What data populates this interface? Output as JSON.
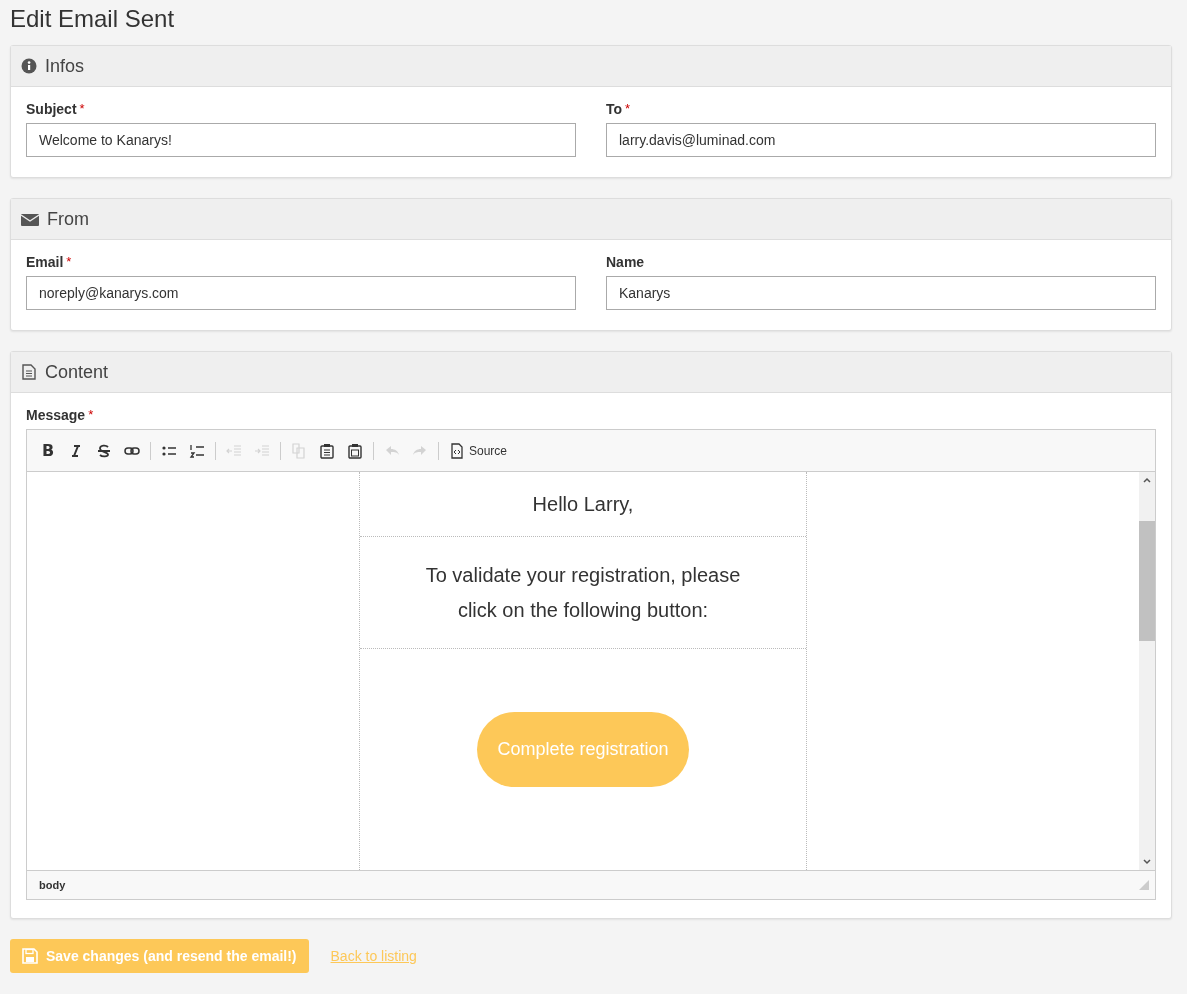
{
  "page_title": "Edit Email Sent",
  "panels": [
    {
      "title": "Infos",
      "fields": [
        {
          "label": "Subject",
          "required_mark": "*",
          "value": "Welcome to Kanarys!"
        },
        {
          "label": "To",
          "required_mark": "*",
          "value": "larry.davis@luminad.com"
        }
      ]
    },
    {
      "title": "From",
      "fields": [
        {
          "label": "Email",
          "required_mark": "*",
          "value": "noreply@kanarys.com"
        },
        {
          "label": "Name",
          "value": "Kanarys"
        }
      ]
    },
    {
      "title": "Content",
      "editor": {
        "label": "Message",
        "required_mark": "*",
        "toolbar": [
          {
            "kind": "bold",
            "disabled": false,
            "label": "B"
          },
          {
            "kind": "italic",
            "disabled": false
          },
          {
            "kind": "strike",
            "disabled": false
          },
          {
            "kind": "link",
            "disabled": false
          },
          {
            "kind": "sep"
          },
          {
            "kind": "bullets",
            "disabled": false
          },
          {
            "kind": "numbers",
            "disabled": false
          },
          {
            "kind": "sep"
          },
          {
            "kind": "outdent",
            "disabled": true
          },
          {
            "kind": "indent",
            "disabled": true
          },
          {
            "kind": "sep"
          },
          {
            "kind": "copy",
            "disabled": true
          },
          {
            "kind": "paste",
            "disabled": false
          },
          {
            "kind": "pasteword",
            "disabled": false
          },
          {
            "kind": "sep"
          },
          {
            "kind": "undo",
            "disabled": true
          },
          {
            "kind": "redo",
            "disabled": true
          },
          {
            "kind": "sep"
          },
          {
            "kind": "source",
            "disabled": false,
            "label": "Source"
          }
        ],
        "email": {
          "greeting": "Hello Larry,",
          "text": "To validate your registration, please click on the following button:",
          "button": "Complete registration"
        },
        "path": "body"
      }
    }
  ],
  "actions": {
    "save": "Save changes (and resend the email!)",
    "back": "Back to listing"
  }
}
